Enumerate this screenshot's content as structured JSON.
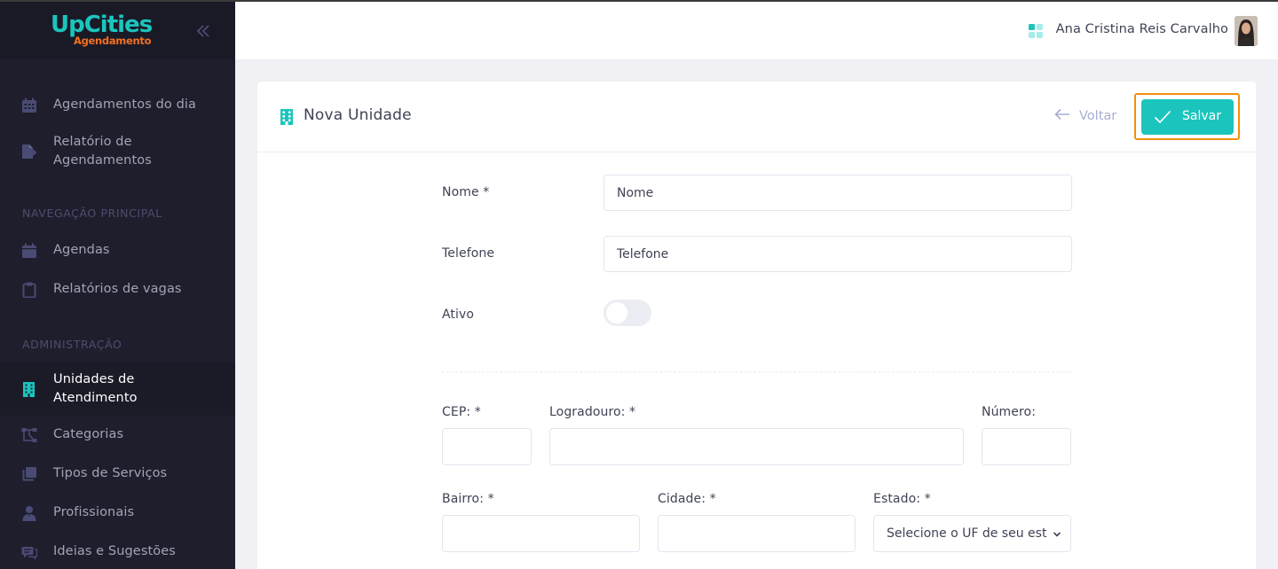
{
  "colors": {
    "accent": "#1bc5bd",
    "sidebar_bg": "#1e1e2d",
    "brand_orange": "#f36f21",
    "highlight": "#f0900e"
  },
  "brand": {
    "name": "UpCities",
    "subtitle": "Agendamento"
  },
  "sidebar": {
    "top_items": [
      {
        "label": "Agendamentos do dia",
        "icon": "calendar-grid-icon"
      },
      {
        "label": "Relatório de Agendamentos",
        "icon": "file-export-icon"
      }
    ],
    "section_main": "NAVEGAÇÃO PRINCIPAL",
    "main_items": [
      {
        "label": "Agendas",
        "icon": "calendar-icon"
      },
      {
        "label": "Relatórios de vagas",
        "icon": "clipboard-icon"
      }
    ],
    "section_admin": "ADMINISTRAÇÃO",
    "admin_items": [
      {
        "label": "Unidades de Atendimento",
        "icon": "building-icon",
        "active": true
      },
      {
        "label": "Categorias",
        "icon": "sitemap-icon"
      },
      {
        "label": "Tipos de Serviços",
        "icon": "layers-icon"
      },
      {
        "label": "Profissionais",
        "icon": "user-tie-icon"
      },
      {
        "label": "Ideias e Sugestões",
        "icon": "comments-icon"
      }
    ]
  },
  "header": {
    "user_name": "Ana Cristina Reis Carvalho"
  },
  "page": {
    "title": "Nova Unidade",
    "back_label": "Voltar",
    "save_label": "Salvar"
  },
  "form": {
    "nome_label": "Nome *",
    "nome_placeholder": "Nome",
    "telefone_label": "Telefone",
    "telefone_placeholder": "Telefone",
    "ativo_label": "Ativo",
    "ativo_value": false,
    "cep_label": "CEP: *",
    "logradouro_label": "Logradouro: *",
    "numero_label": "Número:",
    "bairro_label": "Bairro: *",
    "cidade_label": "Cidade: *",
    "estado_label": "Estado: *",
    "estado_selected": "Selecione o UF de seu est"
  }
}
